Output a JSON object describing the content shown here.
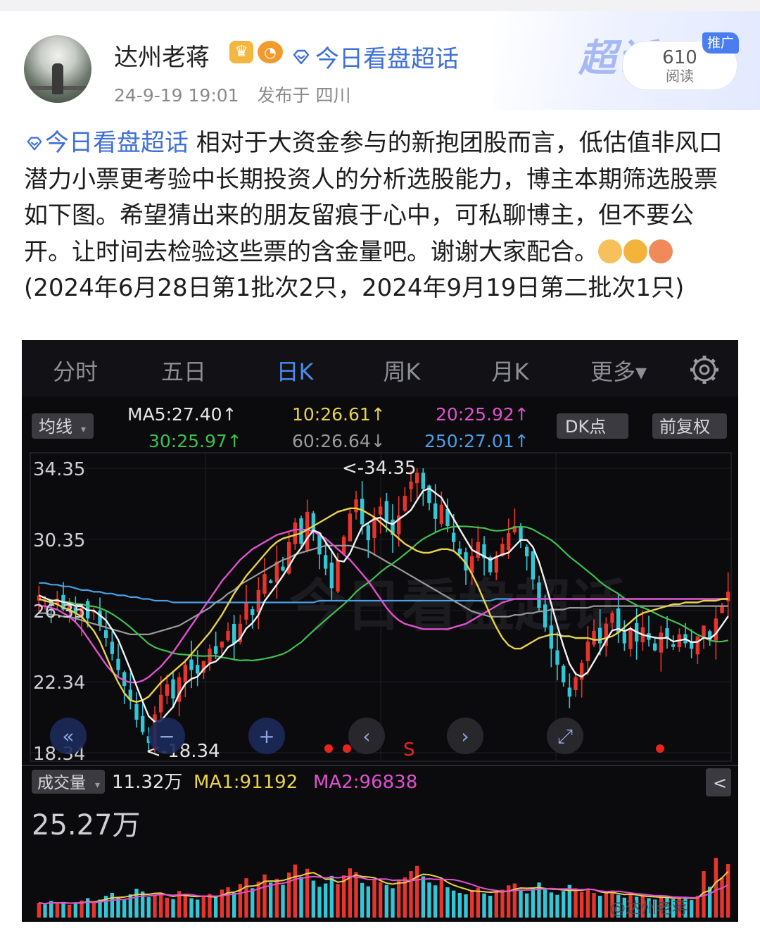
{
  "post": {
    "author": "达州老蒋",
    "badge_crown": "♛",
    "badge_fish": "◔",
    "topic_header": "今日看盘超话",
    "time": "24-9-19 19:01",
    "location": "发布于 四川",
    "promo_label": "推广",
    "read_count": "610",
    "read_label": "阅读",
    "deco_text": "超话",
    "topic_tag": "今日看盘超话",
    "body": " 相对于大资金参与的新抱团股而言，低估值非风口潜力小票更考验中长期投资人的分析选股能力，博主本期筛选股票如下图。希望猜出来的朋友留痕于心中，可私聊博主，但不要公开。让时间去检验这些票的含金量吧。谢谢大家配合。",
    "emojis": [
      "pray-emoji",
      "shush-emoji",
      "kiss-emoji"
    ],
    "body_tail": "(2024年6月28日第1批次2只，2024年9月19日第二批次1只)"
  },
  "chart_ui": {
    "tabs": [
      {
        "label": "分时",
        "active": false
      },
      {
        "label": "五日",
        "active": false
      },
      {
        "label": "日K",
        "active": true
      },
      {
        "label": "周K",
        "active": false
      },
      {
        "label": "月K",
        "active": false
      },
      {
        "label": "更多▾",
        "active": false
      }
    ],
    "settings_icon": "gear-icon",
    "ma_selector": "均线",
    "dk_button": "DK点",
    "adjust_button": "前复权",
    "ma_legend": [
      {
        "text": "MA5:27.40↑",
        "color": "#e6e6e6"
      },
      {
        "text": "10:26.61↑",
        "color": "#e8d24a"
      },
      {
        "text": "20:25.92↑",
        "color": "#e050d0"
      },
      {
        "text": "30:25.97↑",
        "color": "#3fbf4f"
      },
      {
        "text": "60:26.64↓",
        "color": "#9a9a9a"
      },
      {
        "text": "250:27.01↑",
        "color": "#4a9fe8"
      }
    ],
    "high_marker": "<-34.35",
    "low_marker": "<-18.34",
    "watermark": "今日看盘超话",
    "signal_label": "S",
    "volume_selector": "成交量",
    "volume_now": "11.32万",
    "vol_ma1": "MA1:91192",
    "vol_ma2": "MA2:96838",
    "volume_max": "25.27万",
    "collapse_icon": "<",
    "nav_buttons": [
      "zoom-out-button",
      "zoom-in-button",
      "zoom-in-plus-button",
      "prev-button",
      "next-button",
      "fullscreen-button"
    ],
    "bottom_watermark": "@达州老蒋",
    "colors": {
      "up": "#e8342c",
      "down": "#33c6d6",
      "bg": "#0b0b0d"
    }
  },
  "chart_data": {
    "type": "candlestick",
    "y_ticks": [
      34.35,
      30.35,
      26.35,
      22.34,
      18.34
    ],
    "ylim": [
      18.34,
      34.35
    ],
    "high": 34.35,
    "low": 18.34,
    "ma_values": {
      "MA5": 27.4,
      "MA10": 26.61,
      "MA20": 25.92,
      "MA30": 25.97,
      "MA60": 26.64,
      "MA250": 27.01
    },
    "volume": {
      "current": "11.32万",
      "MA1": 91192,
      "MA2": 96838,
      "max_label": "25.27万"
    },
    "close_series": [
      27.2,
      26.9,
      26.6,
      27.0,
      26.4,
      26.8,
      26.2,
      26.5,
      25.9,
      26.3,
      25.5,
      24.8,
      23.9,
      23.0,
      22.1,
      21.3,
      20.2,
      19.5,
      18.9,
      20.5,
      21.6,
      22.2,
      21.4,
      22.6,
      23.3,
      23.0,
      22.8,
      23.5,
      24.2,
      23.9,
      24.6,
      25.2,
      24.5,
      25.6,
      26.8,
      26.1,
      27.5,
      28.4,
      27.9,
      29.1,
      28.6,
      30.2,
      31.3,
      30.1,
      31.9,
      30.8,
      29.5,
      28.7,
      27.6,
      29.2,
      30.5,
      31.8,
      32.6,
      31.2,
      30.3,
      31.6,
      32.2,
      31.3,
      30.6,
      31.7,
      32.8,
      33.6,
      34.1,
      33.2,
      32.4,
      31.5,
      32.3,
      31.1,
      30.2,
      29.5,
      28.6,
      29.4,
      30.2,
      29.3,
      28.5,
      29.4,
      30.1,
      30.7,
      31.1,
      30.3,
      29.4,
      28.1,
      26.5,
      25.4,
      24.2,
      23.3,
      22.3,
      21.5,
      22.6,
      23.4,
      24.6,
      25.2,
      24.5,
      25.6,
      26.2,
      25.1,
      24.5,
      25.3,
      24.6,
      25.4,
      24.7,
      24.1,
      25.1,
      24.8,
      24.3,
      25.0,
      24.5,
      24.2,
      24.9,
      25.5,
      24.7,
      25.9,
      26.6,
      27.4
    ],
    "ma10_series": [
      27.0,
      26.9,
      26.8,
      26.7,
      26.5,
      26.4,
      26.2,
      26.0,
      25.6,
      25.2,
      24.6,
      23.8,
      23.0,
      22.3,
      21.7,
      21.3,
      21.2,
      21.3,
      21.5,
      21.9,
      22.3,
      22.6,
      22.9,
      23.2,
      23.5,
      23.9,
      24.3,
      24.7,
      25.1,
      25.6,
      26.1,
      26.7,
      27.3,
      27.8,
      28.3,
      28.7,
      29.1,
      29.5,
      29.9,
      30.2,
      30.4,
      30.5,
      30.6,
      30.7,
      30.9,
      31.1,
      31.3,
      31.5,
      31.7,
      31.9,
      32.0,
      32.1,
      32.1,
      32.0,
      31.8,
      31.6,
      31.3,
      31.0,
      30.7,
      30.4,
      30.1,
      29.9,
      29.7,
      29.6,
      29.6,
      29.7,
      29.8,
      29.8,
      29.7,
      29.4,
      29.0,
      28.4,
      27.7,
      26.9,
      26.1,
      25.4,
      24.8,
      24.4,
      24.2,
      24.2,
      24.4,
      24.6,
      24.8,
      24.9,
      25.0,
      25.0,
      24.9,
      24.9,
      24.8,
      24.8,
      24.8,
      24.7,
      24.7,
      24.8,
      24.9,
      25.1,
      25.4,
      25.7,
      26.0,
      26.2,
      26.3,
      26.4,
      26.5,
      26.6,
      26.7,
      26.7,
      26.8,
      26.8,
      26.8,
      26.9,
      26.9,
      26.9,
      27.0,
      27.0
    ],
    "ma20_series": [
      26.6,
      26.6,
      26.5,
      26.4,
      26.2,
      26.0,
      25.7,
      25.3,
      24.8,
      24.3,
      23.8,
      23.3,
      22.9,
      22.6,
      22.4,
      22.3,
      22.3,
      22.4,
      22.6,
      22.9,
      23.2,
      23.6,
      24.0,
      24.5,
      25.0,
      25.5,
      26.0,
      26.5,
      27.0,
      27.5,
      28.0,
      28.4,
      28.8,
      29.2,
      29.5,
      29.8,
      30.0,
      30.2,
      30.4,
      30.6,
      30.7,
      30.8,
      30.9,
      30.9,
      30.9,
      30.8,
      30.6,
      30.4,
      30.1,
      29.8,
      29.5,
      29.2,
      28.8,
      28.4,
      28.0,
      27.5,
      27.0,
      26.5,
      26.1,
      25.8,
      25.6,
      25.5,
      25.4,
      25.3,
      25.3,
      25.3,
      25.3,
      25.3,
      25.4,
      25.5,
      25.6,
      25.8,
      26.0,
      26.2,
      26.4,
      26.6,
      26.8,
      26.9,
      27.0,
      27.0,
      27.0,
      27.0,
      27.0,
      27.0,
      27.0,
      27.0,
      27.0,
      27.0,
      27.0,
      27.0,
      27.0,
      27.0,
      27.0,
      27.0,
      27.0,
      27.0,
      27.0,
      27.0,
      27.0,
      27.0,
      27.0,
      27.0,
      27.0,
      27.0,
      27.0,
      27.0,
      27.0,
      27.0,
      27.0,
      27.0,
      27.0,
      27.0,
      27.0,
      27.0
    ],
    "ma60_series": [
      26.2,
      26.2,
      26.1,
      26.1,
      26.0,
      26.0,
      25.9,
      25.8,
      25.7,
      25.6,
      25.5,
      25.4,
      25.3,
      25.2,
      25.1,
      25.0,
      25.0,
      25.0,
      25.0,
      25.1,
      25.2,
      25.3,
      25.4,
      25.5,
      25.7,
      25.9,
      26.1,
      26.3,
      26.5,
      26.8,
      27.0,
      27.3,
      27.5,
      27.8,
      28.0,
      28.2,
      28.4,
      28.6,
      28.8,
      29.0,
      29.2,
      29.3,
      29.5,
      29.6,
      29.7,
      29.8,
      29.9,
      30.0,
      30.0,
      30.0,
      30.0,
      30.0,
      29.9,
      29.8,
      29.7,
      29.5,
      29.3,
      29.1,
      28.9,
      28.7,
      28.5,
      28.3,
      28.1,
      27.9,
      27.7,
      27.5,
      27.3,
      27.1,
      26.9,
      26.7,
      26.5,
      26.3,
      26.2,
      26.1,
      26.0,
      26.0,
      26.0,
      26.0,
      26.1,
      26.1,
      26.2,
      26.2,
      26.3,
      26.3,
      26.4,
      26.4,
      26.4,
      26.5,
      26.5,
      26.5,
      26.5,
      26.6,
      26.6,
      26.6,
      26.6,
      26.6,
      26.6,
      26.6,
      26.6,
      26.6,
      26.6,
      26.6,
      26.6,
      26.6,
      26.6,
      26.6,
      26.6,
      26.6,
      26.6,
      26.6,
      26.6,
      26.6,
      26.6,
      26.6
    ],
    "ma250_series": [
      27.9,
      27.9,
      27.8,
      27.8,
      27.7,
      27.7,
      27.6,
      27.5,
      27.5,
      27.4,
      27.4,
      27.3,
      27.3,
      27.2,
      27.2,
      27.1,
      27.1,
      27.0,
      27.0,
      26.9,
      26.9,
      26.9,
      26.8,
      26.8,
      26.8,
      26.8,
      26.8,
      26.8,
      26.8,
      26.8,
      26.8,
      26.8,
      26.8,
      26.8,
      26.8,
      26.8,
      26.8,
      26.8,
      26.8,
      26.8,
      26.8,
      26.8,
      26.8,
      26.8,
      26.8,
      26.8,
      26.9,
      26.9,
      26.9,
      26.9,
      26.9,
      26.9,
      26.9,
      26.9,
      26.9,
      26.9,
      26.9,
      26.9,
      26.9,
      26.9,
      26.9,
      26.9,
      26.9,
      26.9,
      26.9,
      26.9,
      26.9,
      26.9,
      26.9,
      26.9,
      26.9,
      26.9,
      26.9,
      26.9,
      26.9,
      27.0,
      27.0,
      27.0,
      27.0,
      27.0,
      27.0,
      27.0,
      27.0,
      27.0,
      27.0,
      27.0,
      27.0,
      27.0,
      27.0,
      27.0,
      27.0,
      27.0,
      27.0,
      27.0,
      27.0,
      27.0,
      27.0,
      27.0,
      27.0,
      27.0,
      27.0,
      27.0,
      27.0,
      27.0,
      27.0,
      27.0,
      27.0,
      27.0,
      27.0,
      27.0,
      27.0,
      27.0,
      27.0,
      27.0
    ],
    "volume_series": [
      3.1,
      2.8,
      3.5,
      2.9,
      3.3,
      2.7,
      3.0,
      3.6,
      4.1,
      3.2,
      3.8,
      4.6,
      5.2,
      4.4,
      3.7,
      4.9,
      6.1,
      5.5,
      4.3,
      4.8,
      5.1,
      4.2,
      3.9,
      5.6,
      4.7,
      4.1,
      3.8,
      4.5,
      5.0,
      4.3,
      5.9,
      6.4,
      5.2,
      7.1,
      8.3,
      6.2,
      7.6,
      9.1,
      7.4,
      8.2,
      6.9,
      9.5,
      11.2,
      8.6,
      10.3,
      7.8,
      6.5,
      7.2,
      8.8,
      7.1,
      8.9,
      10.4,
      9.6,
      7.3,
      6.6,
      8.1,
      7.5,
      6.9,
      6.2,
      7.8,
      8.5,
      9.8,
      10.9,
      8.7,
      7.4,
      6.8,
      7.9,
      6.4,
      5.7,
      5.2,
      4.9,
      5.8,
      6.3,
      5.1,
      4.6,
      5.4,
      5.9,
      6.8,
      7.2,
      5.9,
      5.1,
      6.2,
      7.4,
      6.1,
      5.3,
      4.8,
      5.6,
      6.9,
      6.2,
      5.4,
      5.9,
      5.2,
      4.6,
      5.1,
      5.7,
      4.8,
      4.2,
      4.9,
      4.4,
      4.7,
      4.1,
      3.8,
      4.5,
      4.2,
      3.9,
      4.4,
      4.0,
      3.7,
      4.6,
      9.8,
      6.5,
      12.6,
      8.4,
      11.3
    ]
  }
}
